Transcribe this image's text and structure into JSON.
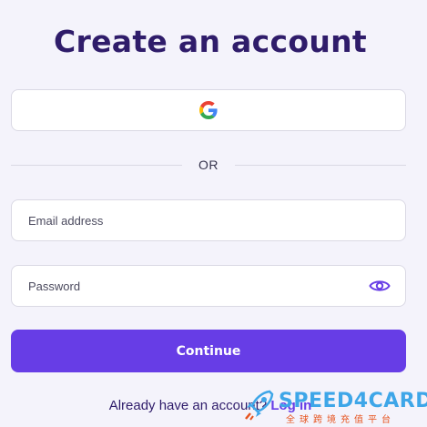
{
  "page": {
    "title": "Create an account"
  },
  "google_button": {
    "icon": "google-icon"
  },
  "divider": {
    "text": "OR"
  },
  "email_field": {
    "placeholder": "Email address",
    "value": ""
  },
  "password_field": {
    "placeholder": "Password",
    "value": "",
    "icon": "eye-icon"
  },
  "continue_button": {
    "label": "Continue"
  },
  "login_prompt": {
    "text": "Already have an account?",
    "link": "Log in"
  },
  "watermark": {
    "brand": "SPEED4CARD",
    "tagline": "全球跨境充值平台",
    "icon": "rocket-icon"
  },
  "colors": {
    "background": "#f4f3fb",
    "title": "#2f1c6a",
    "accent": "#673de6",
    "border": "#dad9e4"
  }
}
